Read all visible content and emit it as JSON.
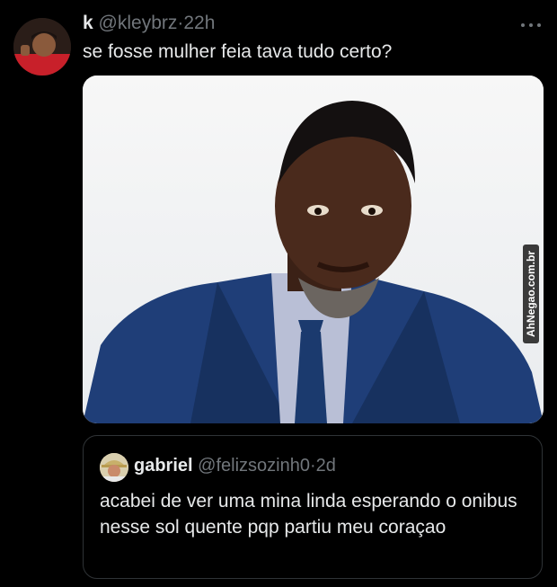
{
  "tweet": {
    "name": "k",
    "handle": "@kleybrz",
    "separator": "·",
    "time": "22h",
    "text": "se fosse mulher feia tava tudo certo?",
    "more_icon": "more-horizontal-icon",
    "media_watermark": "AhNegao.com.br"
  },
  "quoted": {
    "name": "gabriel",
    "handle": "@felizsozinh0",
    "separator": "·",
    "time": "2d",
    "text": "acabei de ver uma mina linda esperando o onibus nesse sol quente pqp partiu meu coraçao"
  },
  "colors": {
    "background": "#000000",
    "text": "#e7e9ea",
    "secondary": "#71767b",
    "border": "#2f3336"
  }
}
